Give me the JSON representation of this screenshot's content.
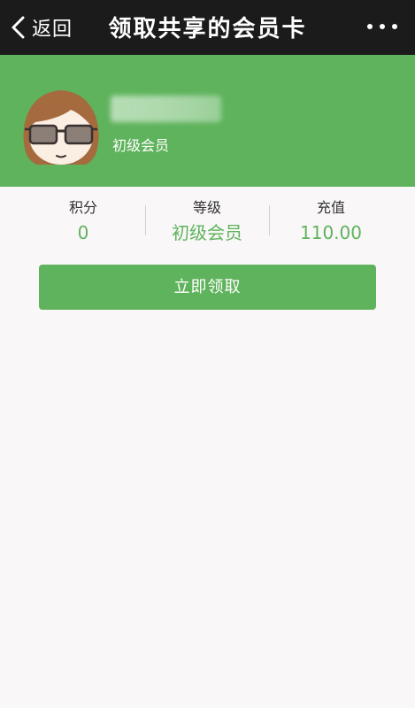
{
  "navbar": {
    "back_label": "返回",
    "title": "领取共享的会员卡",
    "more_icon": "more-dots-icon",
    "background": "#1b1b1b"
  },
  "header": {
    "member_level": "初级会员",
    "background": "#5fb35c"
  },
  "stats": [
    {
      "label": "积分",
      "value": "0"
    },
    {
      "label": "等级",
      "value": "初级会员"
    },
    {
      "label": "充值",
      "value": "110.00"
    }
  ],
  "claim_button": {
    "label": "立即领取",
    "color": "#5fb35c"
  }
}
